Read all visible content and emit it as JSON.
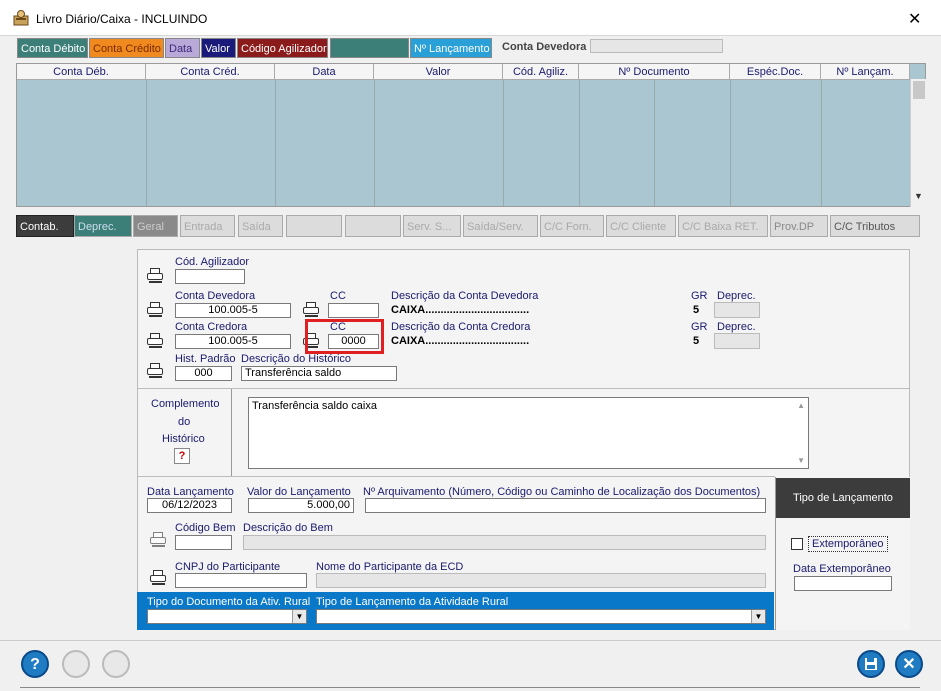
{
  "window": {
    "title": "Livro Diário/Caixa  -  INCLUINDO",
    "close_glyph": "✕"
  },
  "top_tabs": [
    {
      "label": "Conta Débito",
      "bg": "#3c7f78",
      "fg": "#ffffff"
    },
    {
      "label": "Conta Crédito",
      "bg": "#f08a1e",
      "fg": "#7a2a00"
    },
    {
      "label": "Data",
      "bg": "#b8a9d9",
      "fg": "#3a2a7a"
    },
    {
      "label": "Valor",
      "bg": "#1a1a7a",
      "fg": "#ffffff"
    },
    {
      "label": "Código Agilizador",
      "bg": "#8b1a1a",
      "fg": "#ffffff"
    },
    {
      "label": "",
      "bg": "#3c7f78",
      "fg": "#ffffff"
    },
    {
      "label": "Nº Lançamento",
      "bg": "#2aa0d8",
      "fg": "#ffffff"
    }
  ],
  "top_right": {
    "label": "Conta Devedora",
    "value": ""
  },
  "grid": {
    "columns": [
      "Conta Déb.",
      "Conta Créd.",
      "Data",
      "Valor",
      "Cód. Agiliz.",
      "Nº Documento",
      "Espéc.Doc.",
      "Nº Lançam."
    ]
  },
  "bottom_tabs": [
    "Contab.",
    "Deprec.",
    "Geral",
    "Entrada",
    "Saída",
    "",
    "",
    "Serv. S...",
    "Saída/Serv.",
    "C/C Forn.",
    "C/C Cliente",
    "C/C Baixa RET.",
    "Prov.DP",
    "C/C Tributos"
  ],
  "form": {
    "cod_agilizador": {
      "label": "Cód. Agilizador",
      "value": ""
    },
    "conta_devedora": {
      "label": "Conta Devedora",
      "value": "100.005-5"
    },
    "cc_devedora": {
      "label": "CC",
      "value": ""
    },
    "desc_devedora": {
      "label": "Descrição da Conta Devedora",
      "value": "CAIXA.................................."
    },
    "gr_devedora": {
      "label": "GR",
      "value": "5"
    },
    "deprec_devedora": {
      "label": "Deprec.",
      "value": ""
    },
    "conta_credora": {
      "label": "Conta Credora",
      "value": "100.005-5"
    },
    "cc_credora": {
      "label": "CC",
      "value": "0000"
    },
    "desc_credora": {
      "label": "Descrição da Conta Credora",
      "value": "CAIXA.................................."
    },
    "gr_credora": {
      "label": "GR",
      "value": "5"
    },
    "deprec_credora": {
      "label": "Deprec.",
      "value": ""
    },
    "hist_padrao": {
      "label": "Hist. Padrão",
      "value": "000"
    },
    "desc_historico": {
      "label": "Descrição do Histórico",
      "value": "Transferência saldo"
    },
    "complemento": {
      "label1": "Complemento",
      "label2": "do",
      "label3": "Histórico",
      "help": "?",
      "value": "Transferência saldo caixa"
    },
    "data_lancamento": {
      "label": "Data Lançamento",
      "value": "06/12/2023"
    },
    "valor_lancamento": {
      "label": "Valor do Lançamento",
      "value": "5.000,00"
    },
    "num_arquivamento": {
      "label": "Nº Arquivamento (Número, Código ou Caminho de Localização dos Documentos)",
      "value": ""
    },
    "codigo_bem": {
      "label": "Código Bem",
      "value": ""
    },
    "descricao_bem": {
      "label": "Descrição do Bem",
      "value": ""
    },
    "cnpj_participante": {
      "label": "CNPJ do Participante",
      "value": ""
    },
    "nome_participante": {
      "label": "Nome do Participante da ECD",
      "value": ""
    },
    "tipo_doc_rural": {
      "label": "Tipo do Documento da Ativ. Rural",
      "value": ""
    },
    "tipo_lanc_rural": {
      "label": "Tipo de Lançamento da Atividade Rural",
      "value": ""
    }
  },
  "tipo_lancamento": {
    "title": "Tipo de Lançamento",
    "extemporaneo": "Extemporâneo",
    "data_extemporaneo": "Data Extemporâneo",
    "data_value": ""
  },
  "colors": {
    "grid_bg": "#a9c6d1",
    "blue_bar": "#0a78c8",
    "highlight": "#e02020",
    "dark_panel": "#3c3c3c"
  }
}
